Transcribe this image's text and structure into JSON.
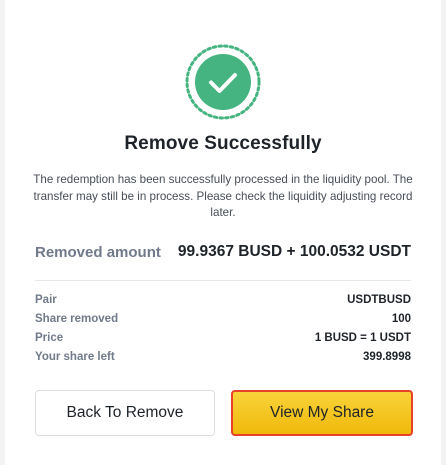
{
  "title": "Remove Successfully",
  "description": "The redemption has been successfully processed in the liquidity pool. The transfer may still be in process. Please check the liquidity adjusting record later.",
  "removed": {
    "label": "Removed amount",
    "value": "99.9367 BUSD + 100.0532 USDT"
  },
  "details": [
    {
      "label": "Pair",
      "value": "USDTBUSD"
    },
    {
      "label": "Share removed",
      "value": "100"
    },
    {
      "label": "Price",
      "value": "1 BUSD = 1 USDT"
    },
    {
      "label": "Your share left",
      "value": "399.8998"
    }
  ],
  "buttons": {
    "back": "Back To Remove",
    "view": "View My Share"
  },
  "colors": {
    "success": "#45b480",
    "accent": "#f0b90b",
    "highlight_border": "#e8412a"
  },
  "icons": {
    "success": "check-circle-icon"
  }
}
